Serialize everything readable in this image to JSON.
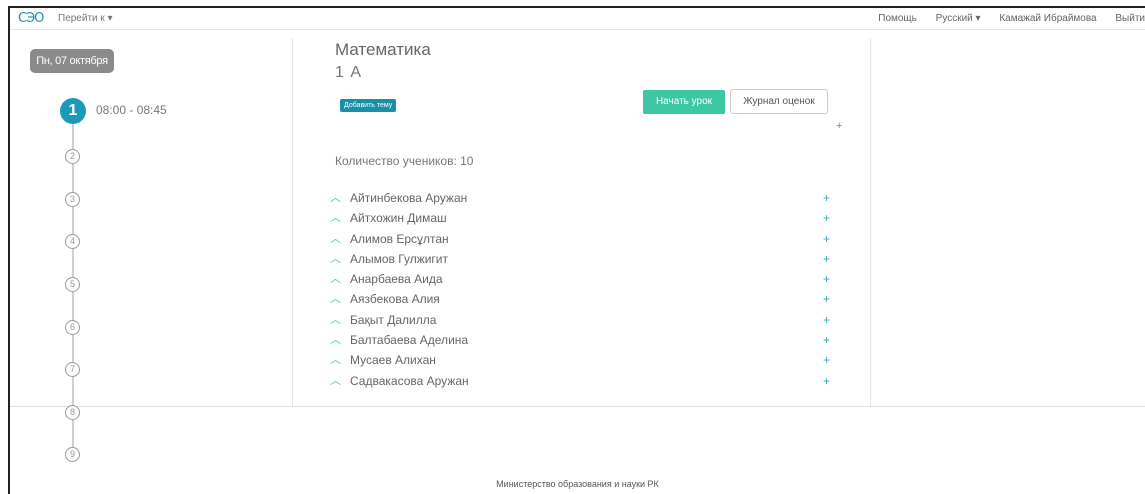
{
  "topnav": {
    "logo": "СЭО",
    "goto": "Перейти к ▾",
    "help": "Помощь",
    "language": "Русский ▾",
    "user": "Камажай Ибраймова",
    "logout": "Выйти"
  },
  "schedule": {
    "date": "Пн, 07 октября",
    "lessons": [
      {
        "number": "1",
        "time": "08:00 - 08:45",
        "active": true
      },
      {
        "number": "2"
      },
      {
        "number": "3"
      },
      {
        "number": "4"
      },
      {
        "number": "5"
      },
      {
        "number": "6"
      },
      {
        "number": "7"
      },
      {
        "number": "8"
      },
      {
        "number": "9"
      }
    ]
  },
  "lesson": {
    "subject": "Математика",
    "class": "1 А",
    "add_topic_label": "Добавить тему",
    "start_label": "Начать урок",
    "journal_label": "Журнал оценок",
    "student_count": "Количество учеников: 10",
    "students": [
      "Айтинбекова Аружан",
      "Айтхожин Димаш",
      "Алимов Ерсұлтан",
      "Алымов Гулжигит",
      "Анарбаева Аида",
      "Аязбекова Алия",
      "Бақыт Далилла",
      "Балтабаева Аделина",
      "Мусаев Алихан",
      "Садвакасова Аружан"
    ]
  },
  "icons": {
    "chevron": "chevron-up-icon",
    "plus": "plus-icon"
  },
  "colors": {
    "accent_blue": "#1a9ab8",
    "accent_green": "#3ec7a5"
  },
  "footer": {
    "text": "Министерство образования и науки РК"
  }
}
